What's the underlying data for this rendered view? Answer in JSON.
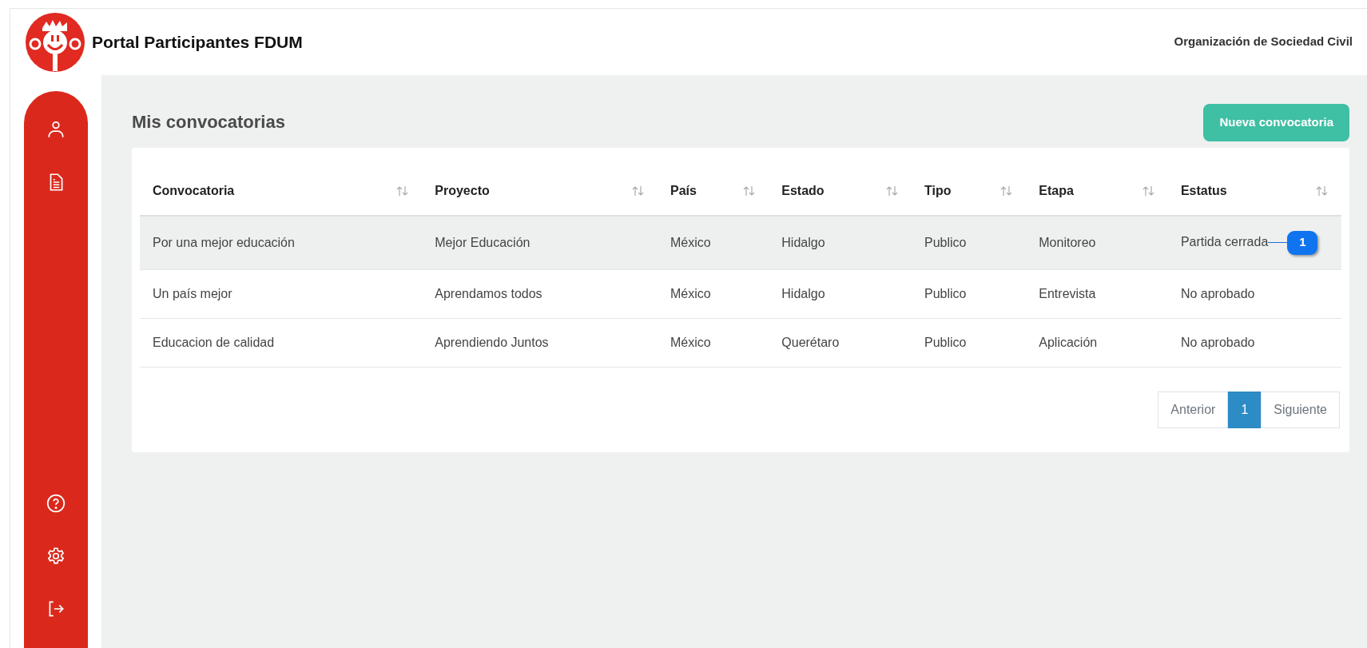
{
  "header": {
    "title": "Portal Participantes FDUM",
    "organization": "Organización de Sociedad Civil"
  },
  "page_title": "Mis convocatorias",
  "new_button": "Nueva convocatoria",
  "table": {
    "columns": [
      "Convocatoria",
      "Proyecto",
      "País",
      "Estado",
      "Tipo",
      "Etapa",
      "Estatus"
    ],
    "rows": [
      {
        "cells": [
          "Por una mejor educación",
          "Mejor Educación",
          "México",
          "Hidalgo",
          "Publico",
          "Monitoreo",
          "Partida cerrada"
        ],
        "highlighted": true,
        "callout": "1"
      },
      {
        "cells": [
          "Un país mejor",
          "Aprendamos todos",
          "México",
          "Hidalgo",
          "Publico",
          "Entrevista",
          "No aprobado"
        ],
        "highlighted": false
      },
      {
        "cells": [
          "Educacion de calidad",
          "Aprendiendo Juntos",
          "México",
          "Querétaro",
          "Publico",
          "Aplicación",
          "No aprobado"
        ],
        "highlighted": false
      }
    ]
  },
  "pagination": {
    "previous": "Anterior",
    "pages": [
      {
        "label": "1",
        "selected": true
      }
    ],
    "next": "Siguiente"
  }
}
